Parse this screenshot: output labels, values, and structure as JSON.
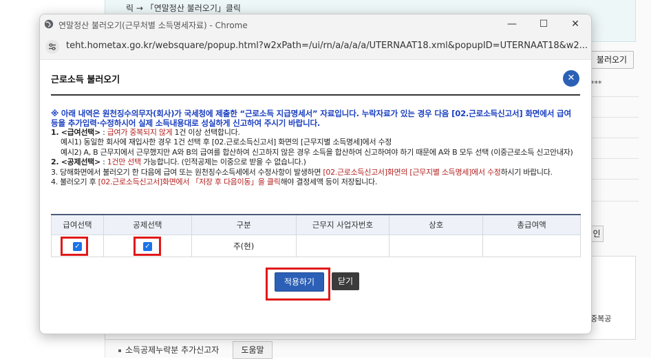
{
  "background": {
    "top_text": "릭 → 「연말정산 불러오기」클릭",
    "load_button": "불러오기",
    "stars": "***",
    "in_button": "인",
    "side_text": "중복공",
    "bottom_label": "소득공제누락분 추가신고자",
    "help_button": "도움말"
  },
  "window": {
    "title": "연말정산 불러오기(근무처별 소득명세자료) - Chrome",
    "url": "teht.hometax.go.kr/websquare/popup.html?w2xPath=/ui/rn/a/a/a/a/UTERNAAT18.xml&popupID=UTERNAAT18&w2...",
    "minimize": "—",
    "maximize": "☐",
    "close": "✕"
  },
  "dialog": {
    "title": "근로소득 불러오기",
    "close_icon": "✕",
    "notice": "※ 아래 내역은 원천징수의무자(회사)가 국세청에 제출한 “근로소득 지급명세서” 자료입니다. 누락자료가 있는 경우 다음 [02.근로소득신고서] 화면에서 급여 등을 추가입력·수정하시어 실제 소득내용대로 성실하게 신고하여 주시기 바랍니다.",
    "note1_prefix": "1. <급여선택>",
    "note1_colon": " : ",
    "note1_red": "급여가 중복되지 않게",
    "note1_rest": " 1건 이상 선택합니다.",
    "note1_ex1": "예시1) 동일한 회사에 재입사한 경우 1건 선택 후 [02.근로소득신고서] 화면의 [근무지별 소득명세]에서 수정",
    "note1_ex2": "예시2) A, B 근무지에서 근무했지만 A와 B의 급여를 합산하여 신고하지 않은 경우 소득을 합산하여 신고하여야 하기 때문에 A와 B 모두 선택 (이중근로소득 신고안내자)",
    "note2_prefix": "2. <공제선택>",
    "note2_colon": " : ",
    "note2_red": "1건만 선택",
    "note2_rest": " 가능합니다. (인적공제는 이중으로 받을 수 없습니다.)",
    "note3_a": "3. 당해화면에서 불러오기 한 다음에 급여 또는 원천징수소득세에서 수정사항이 발생하면 ",
    "note3_red": "[02.근로소득신고서]화면의 [근무지별 소득명세]에서 수정",
    "note3_b": "하시기 바랍니다.",
    "note4_a": "4. 불러오기 후 ",
    "note4_red": "[02.근로소득신고서]화면에서 「저장 후 다음이동」을 클릭",
    "note4_b": "해야 결정세액 등이 저장됩니다."
  },
  "table": {
    "headers": [
      "급여선택",
      "공제선택",
      "구분",
      "근무지 사업자번호",
      "상호",
      "총급여액"
    ],
    "rows": [
      {
        "salary_checked": true,
        "deduction_checked": true,
        "type": "주(현)",
        "biz_no": "",
        "name": "",
        "total": ""
      }
    ]
  },
  "buttons": {
    "apply": "적용하기",
    "close": "닫기"
  },
  "colors": {
    "accent": "#2c60b6",
    "highlight": "#e01818",
    "notice": "#1a3fc0",
    "red_text": "#b42020"
  }
}
